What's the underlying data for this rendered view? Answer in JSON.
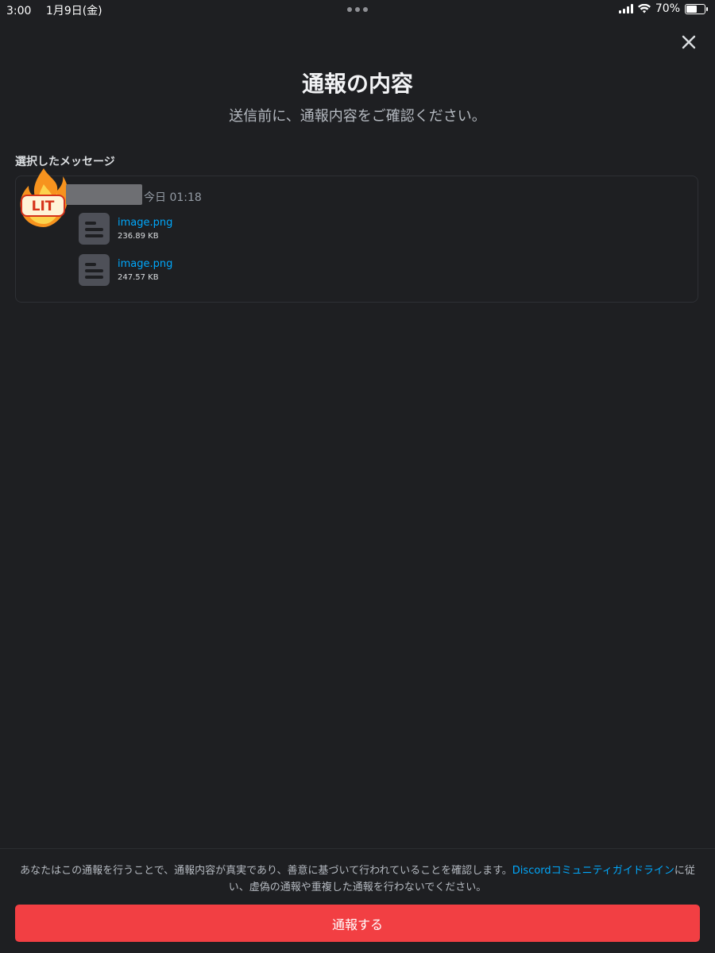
{
  "status_bar": {
    "time": "3:00",
    "date": "1月9日(金)",
    "battery": "70%",
    "battery_level": 0.7
  },
  "dialog": {
    "title": "通報の内容",
    "subtitle": "送信前に、通報内容をご確認ください。",
    "close_icon": "close-icon"
  },
  "message": {
    "section_label": "選択したメッセージ",
    "avatar_text": "LIT",
    "timestamp": "今日 01:18",
    "attachments": [
      {
        "name": "image.png",
        "size": "236.89 KB",
        "icon": "file-icon"
      },
      {
        "name": "image.png",
        "size": "247.57 KB",
        "icon": "file-icon"
      }
    ]
  },
  "footer": {
    "disclaimer_before": "あなたはこの通報を行うことで、通報内容が真実であり、善意に基づいて行われていることを確認します。",
    "guidelines_link": "Discordコミュニティガイドライン",
    "disclaimer_after": "に従い、虚偽の通報や重複した通報を行わないでください。",
    "report_button": "通報する"
  },
  "colors": {
    "background": "#1e1f22",
    "link": "#00a8fc",
    "danger": "#f23f43"
  }
}
